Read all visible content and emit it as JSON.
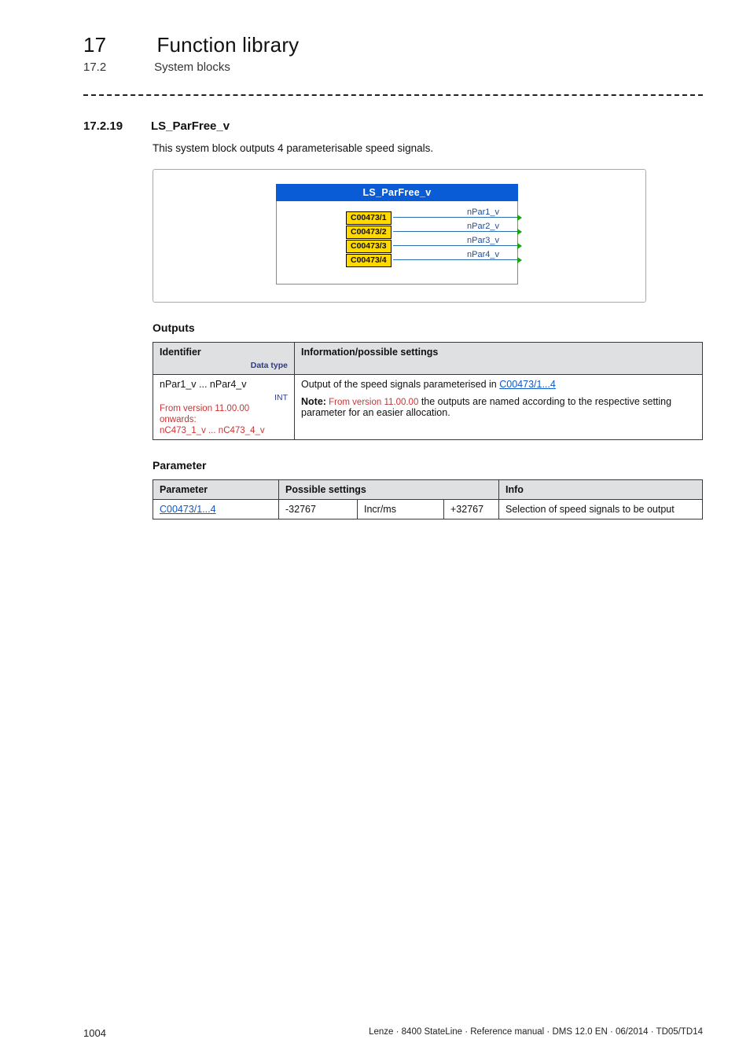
{
  "header": {
    "chapter_number": "17",
    "chapter_title": "Function library",
    "section_number": "17.2",
    "section_title": "System blocks"
  },
  "section": {
    "number": "17.2.19",
    "title": "LS_ParFree_v",
    "intro": "This system block outputs 4 parameterisable speed signals."
  },
  "diagram": {
    "block_title": "LS_ParFree_v",
    "codes": [
      "C00473/1",
      "C00473/2",
      "C00473/3",
      "C00473/4"
    ],
    "outputs": [
      "nPar1_v",
      "nPar2_v",
      "nPar3_v",
      "nPar4_v"
    ]
  },
  "outputs_section": {
    "heading": "Outputs",
    "head_identifier": "Identifier",
    "head_datatype": "Data type",
    "head_info": "Information/possible settings",
    "row": {
      "ident_main": "nPar1_v ... nPar4_v",
      "ident_type": "INT",
      "ident_note_prefix": "From version 11.00.00 onwards:",
      "ident_note_body": "nC473_1_v ... nC473_4_v",
      "info_line1_pre": "Output of the speed signals parameterised in ",
      "info_line1_link": "C00473/1...4",
      "info_note_label": "Note:",
      "info_note_red": " From version 11.00.00",
      "info_note_rest": " the outputs are named according to the respective setting parameter for an easier allocation."
    }
  },
  "param_section": {
    "heading": "Parameter",
    "head_param": "Parameter",
    "head_settings": "Possible settings",
    "head_info": "Info",
    "row": {
      "param_link": "C00473/1...4",
      "min": "-32767",
      "unit": "Incr/ms",
      "max": "+32767",
      "info": "Selection of speed signals to be output"
    }
  },
  "footer": {
    "page": "1004",
    "meta": "Lenze · 8400 StateLine · Reference manual · DMS 12.0 EN · 06/2014 · TD05/TD14"
  }
}
